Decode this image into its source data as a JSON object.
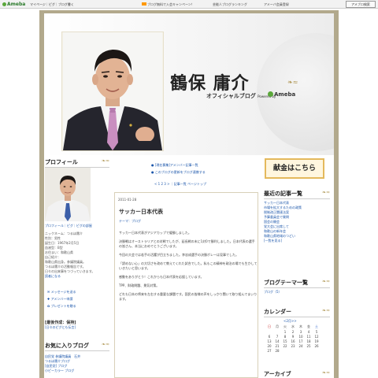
{
  "topbar": {
    "logo": "Ameba",
    "links": "マイページ｜ピグ｜ブログ書く",
    "notice1": "ブログ無料で入会キャンペーン！",
    "notice2": "芸能人ブログランキング",
    "notice3": "アメーバ会員登録",
    "search_button": "アメブロ検索"
  },
  "header": {
    "title": "鶴保 庸介",
    "subtitle": "オフィシャルブログ",
    "powered_by": "Powered by",
    "ameba": "Ameba"
  },
  "profile": {
    "heading": "プロフィール",
    "links": "プロフィール｜ピグ｜ピグの部屋",
    "text": [
      "ニックネーム：つるほ庸介",
      "性別：男性",
      "誕生日：1967年2月5日",
      "血液型：B型",
      "お住まい：和歌山県",
      "自己紹介：",
      "和歌山県出身。参議院議員。",
      "つるほ庸介の活動報告です。",
      "日々の出来事をつづっていきます。"
    ],
    "more": "読者になる",
    "message": "メッセージを送る",
    "amember": "アメンバー申請",
    "gift": "プレゼントを贈る",
    "status_label": "[最後作成：保持]",
    "status_sub": "[日々のピグとも伝言]"
  },
  "fav": {
    "heading": "お気に入りブログ",
    "items": [
      "自民党 参議院議員　石井",
      "つるほ庸介ブログ",
      "[自民党] ブログ",
      "小ピーカラー ブログ"
    ]
  },
  "mid_links": {
    "amember": "[現在募集]アメンバー記事一覧",
    "latest": "このブログの更新をブログ連携する"
  },
  "pager": {
    "prev": "<",
    "nums": [
      "1",
      "2",
      "3"
    ],
    "next": ">",
    "all": "記事一覧",
    "page": "ページトップ"
  },
  "article": {
    "date": "2011-01-28",
    "title": "サッカー日本代表",
    "theme": "テーマ：ブログ",
    "paragraphs": [
      "サッカー日本代表がアジアカップで優勝しました。",
      "決勝戦はオーストラリアとの対戦でしたが、延長戦の末に1対0で勝利しました。日本代表の選手の皆さん、本当におめでとうございます。",
      "今回の大会では若手の活躍が目立ちました。李忠成選手の決勝ボレーは見事でした。",
      "「諦めない心」の大切さを改めて教えてくれた試合でした。私もこの精神を政治の場でも生かしていきたいと思います。",
      "感動をありがとう！これからも日本代表を応援しています。",
      "TPP、財政問題、景気対策。",
      "どれも日本の将来を左右する重要な課題です。国民の皆様の声をしっかり聞いて取り組んでまいります。"
    ]
  },
  "right": {
    "donate": "献金はこちら",
    "latest_heading": "最近の記事一覧",
    "latest_items": [
      "サッカー日本代表",
      "市場を拡大するための政策",
      "税制改正関連法案",
      "予算委員会で質問",
      "国会の開会",
      "党大会に出席して",
      "和歌山の新年会",
      "和歌山県地域のつどい"
    ],
    "latest_more": "[一覧を見る]",
    "theme_heading": "ブログテーマ一覧",
    "theme_items": [
      "ブログ（5）"
    ],
    "calendar_heading": "カレンダー",
    "calendar_month": "<2月>>",
    "calendar_days": [
      "日",
      "月",
      "火",
      "水",
      "木",
      "金",
      "土"
    ],
    "calendar_rows": [
      [
        "",
        "",
        "1",
        "2",
        "3",
        "4",
        "5"
      ],
      [
        "6",
        "7",
        "8",
        "9",
        "10",
        "11",
        "12"
      ],
      [
        "13",
        "14",
        "15",
        "16",
        "17",
        "18",
        "19"
      ],
      [
        "20",
        "21",
        "22",
        "23",
        "24",
        "25",
        "26"
      ],
      [
        "27",
        "28",
        "",
        "",
        "",
        "",
        ""
      ]
    ],
    "archive_heading": "アーカイブ"
  }
}
